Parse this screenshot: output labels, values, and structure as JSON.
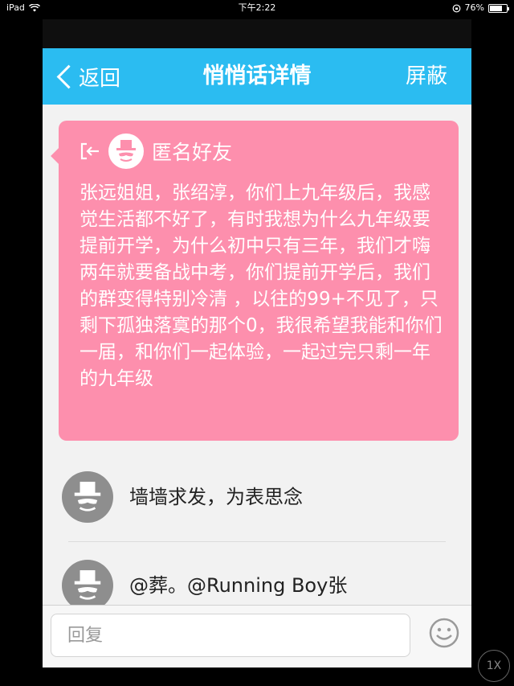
{
  "status_bar": {
    "device": "iPad",
    "time": "下午2:22",
    "battery": "76%",
    "battery_level": 0.76
  },
  "nav": {
    "back_label": "返回",
    "title": "悄悄话详情",
    "right_label": "屏蔽"
  },
  "post": {
    "author": "匿名好友",
    "text": "张远姐姐，张绍淳，你们上九年级后，我感觉生活都不好了，有时我想为什么九年级要提前开学，为什么初中只有三年，我们才嗨两年就要备战中考，你们提前开学后，我们的群变得特别冷清 ，以往的99+不见了，只剩下孤独落寞的那个0，我很希望我能和你们一届，和你们一起体验，一起过完只剩一年的九年级"
  },
  "comments": [
    {
      "text": "墙墙求发，为表思念"
    },
    {
      "text": "@葬。@Running Boy张"
    }
  ],
  "input": {
    "placeholder": "回复"
  },
  "speed_badge": "1X",
  "colors": {
    "nav": "#2bbcf1",
    "card": "#fd8fad",
    "background": "#f2f2f2"
  },
  "icons": [
    "wifi-icon",
    "battery-icon",
    "back-chevron-icon",
    "exit-icon",
    "anonymous-avatar-icon",
    "emoji-icon"
  ]
}
